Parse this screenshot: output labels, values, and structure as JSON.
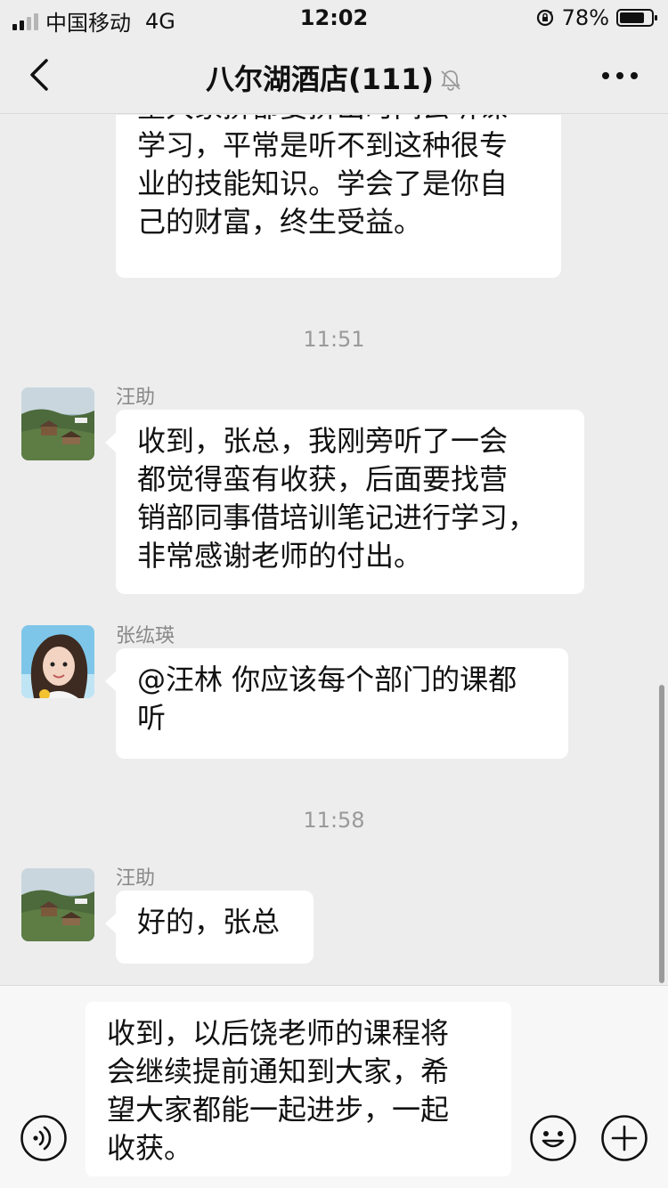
{
  "status_bar": {
    "carrier": "中国移动",
    "network": "4G",
    "time": "12:02",
    "battery_text": "78%",
    "battery_level": 0.78
  },
  "nav": {
    "title": "八尔湖酒店(111)",
    "back_icon": "chevron-left-icon",
    "mute_icon": "bell-slash-icon",
    "more_icon": "more-dots-icon"
  },
  "messages": {
    "m0": {
      "text": "望大家挤都要挤出时间去听课\n学习，平常是听不到这种很专\n业的技能知识。学会了是你自\n己的财富，终生受益。"
    },
    "t1": "11:51",
    "m1": {
      "sender": "汪助",
      "text": "收到，张总，我刚旁听了一会\n都觉得蛮有收获，后面要找营\n销部同事借培训笔记进行学习，\n非常感谢老师的付出。"
    },
    "m2": {
      "sender": "张纮瑛",
      "text": "@汪林 你应该每个部门的课都\n听"
    },
    "t2": "11:58",
    "m3": {
      "sender": "汪助",
      "text": "好的，张总"
    }
  },
  "input": {
    "text": "收到，以后饶老师的课程将\n会继续提前通知到大家，希\n望大家都能一起进步，一起\n收获。",
    "voice_icon": "voice-icon",
    "emoji_icon": "emoji-icon",
    "plus_icon": "plus-icon"
  }
}
